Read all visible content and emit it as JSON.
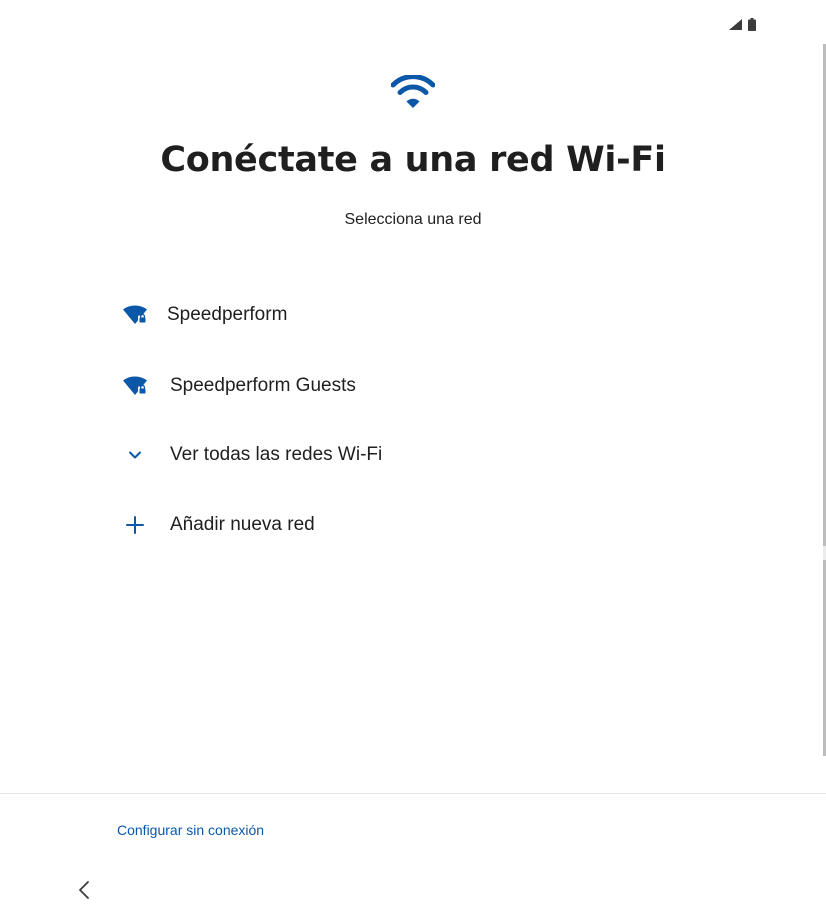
{
  "status_bar": {
    "icons": [
      "signal-icon",
      "battery-icon"
    ]
  },
  "header": {
    "icon": "wifi-icon",
    "title": "Conéctate a una red Wi-Fi",
    "subtitle": "Selecciona una red"
  },
  "networks": [
    {
      "name": "Speedperform",
      "icon": "wifi-locked-icon"
    },
    {
      "name": "Speedperform Guests",
      "icon": "wifi-locked-icon"
    }
  ],
  "actions": {
    "see_all_label": "Ver todas las redes Wi-Fi",
    "see_all_icon": "chevron-down-icon",
    "add_network_label": "Añadir nueva red",
    "add_network_icon": "plus-icon"
  },
  "footer": {
    "offline_link": "Configurar sin conexión",
    "back_icon": "back-chevron-icon"
  },
  "colors": {
    "accent": "#0b57a8",
    "text": "#1f1f1f",
    "background": "#ffffff"
  }
}
